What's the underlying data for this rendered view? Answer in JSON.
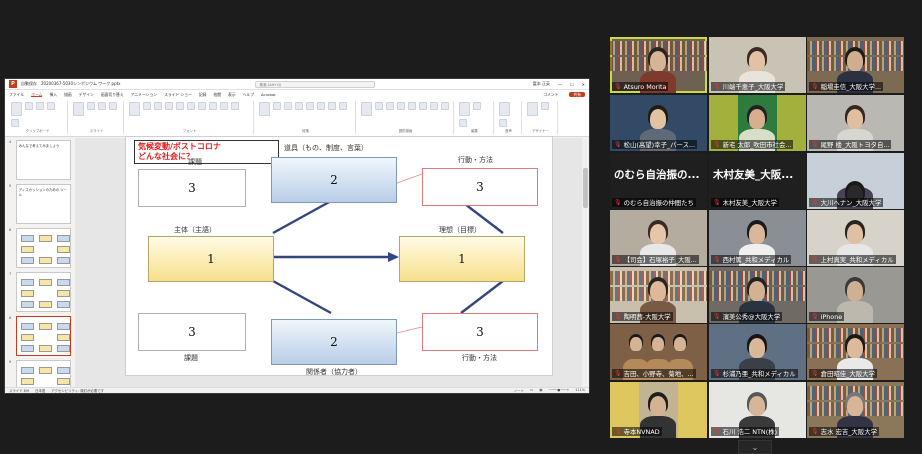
{
  "powerpoint": {
    "window_title": "20200367-5030シンポジウム ワーク.pptx",
    "autosave_label": "自動保存",
    "search_placeholder": "検索 (Alt+Q)",
    "user_name": "富本 正英",
    "menu": [
      "ファイル",
      "ホーム",
      "挿入",
      "描画",
      "デザイン",
      "画面切り替え",
      "アニメーション",
      "スライド ショー",
      "記録",
      "校閲",
      "表示",
      "ヘルプ",
      "Acrobat"
    ],
    "active_menu_index": 1,
    "share_label": "共有",
    "comment_label": "コメント",
    "ribbon_groups": [
      "クリップボード",
      "スライド",
      "フォント",
      "段落",
      "図形描画",
      "編集",
      "音声",
      "デザイナー"
    ],
    "thumbnails": [
      {
        "num": "4",
        "title": "みんなで考えてみましょう"
      },
      {
        "num": "5",
        "title": "ディスカッションのための ツール"
      },
      {
        "num": "6",
        "title": ""
      },
      {
        "num": "7",
        "title": ""
      },
      {
        "num": "8",
        "title": ""
      },
      {
        "num": "9",
        "title": ""
      }
    ],
    "status_left": "スライド 8/9",
    "status_lang": "日本語",
    "status_access": "アクセシビリティ: 検討が必要です",
    "status_notes": "ノート",
    "zoom": "111%"
  },
  "slide": {
    "callout_line1": "気候変動/ポストコロナ",
    "callout_line2": "どんな社会に？",
    "top_tool_label": "道具（もの、制度、言葉）",
    "top_tool_value": "2",
    "bottom_stake_label": "関係者（協力者）",
    "bottom_stake_value": "2",
    "subject_label": "主体（主語）",
    "subject_value": "1",
    "ideal_label": "理想（目標）",
    "ideal_value": "1",
    "issue_top_label": "課題",
    "issue_top_value": "3",
    "issue_bottom_label": "課題",
    "issue_bottom_value": "3",
    "action_top_label": "行動・方法",
    "action_top_value": "3",
    "action_bottom_label": "行動・方法",
    "action_bottom_value": "3"
  },
  "participants": [
    {
      "name": "Atsuro Morita",
      "active": true
    },
    {
      "name": "川端千恵子_大阪大学"
    },
    {
      "name": "稲場圭信_大阪大学..."
    },
    {
      "name": "松山(高望)幸子_パース..."
    },
    {
      "name": "新宅 太郎_吹田市社会..."
    },
    {
      "name": "尾野 楼_大阪トヨタ自..."
    },
    {
      "name": "のむら自治振の仲間たち",
      "big": "のむら自治振の..."
    },
    {
      "name": "木村友美_大阪大学",
      "big": "木村友美_大阪..."
    },
    {
      "name": "大川ヘナン_大阪大学"
    },
    {
      "name": "【司会】石塚裕子_大阪..."
    },
    {
      "name": "西村篤_共和メディカル"
    },
    {
      "name": "上村真実_共和メディカル"
    },
    {
      "name": "陶明茜-大阪大学"
    },
    {
      "name": "濱美公秀@大阪大学"
    },
    {
      "name": "iPhone"
    },
    {
      "name": "吉田、小野寺、菊地、..."
    },
    {
      "name": "杉浦乃亜_共和メディカル"
    },
    {
      "name": "倉田昭佳_大阪大学"
    },
    {
      "name": "寺本NVNAD"
    },
    {
      "name": "石川 浩二 NTN(株)"
    },
    {
      "name": "志水 宏吉_大阪大学"
    }
  ],
  "colors": {
    "accent": "#c43e1c",
    "active_speaker": "#c9dc3c",
    "mic_muted": "#e33333",
    "callout_text": "#e21b1b",
    "arrow": "#33467f"
  }
}
